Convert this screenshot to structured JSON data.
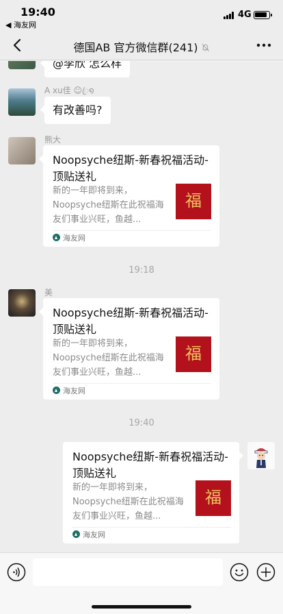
{
  "status_bar": {
    "time": "19:40",
    "back_app": "◀ 海友网",
    "network": "4G",
    "icons": {
      "signal": "signal-bars-icon",
      "battery": "battery-icon"
    }
  },
  "nav": {
    "title": "德国AB  官方微信群(241)",
    "icons": {
      "back": "chevron-left-icon",
      "mute": "mute-bell-icon",
      "more": "more-dots-icon"
    }
  },
  "messages": [
    {
      "type": "text",
      "text": "@李欣 怎么样"
    },
    {
      "type": "text",
      "sender": "A xu佳 ☺ꦿ໑",
      "text": "有改善吗?"
    },
    {
      "type": "link_card",
      "sender": "熊大",
      "card": {
        "title": "Noopsyche纽斯-新春祝福活动-顶贴送礼",
        "desc": "新的一年即将到来，Noopsyche纽斯在此祝福海友们事业兴旺，鱼越...",
        "source": "海友网",
        "thumb_text": "福"
      }
    },
    {
      "type": "time",
      "text": "19:18"
    },
    {
      "type": "link_card",
      "sender": "美",
      "card": {
        "title": "Noopsyche纽斯-新春祝福活动-顶贴送礼",
        "desc": "新的一年即将到来，Noopsyche纽斯在此祝福海友们事业兴旺，鱼越...",
        "source": "海友网",
        "thumb_text": "福"
      }
    },
    {
      "type": "time",
      "text": "19:40"
    },
    {
      "type": "link_card",
      "outgoing": true,
      "card": {
        "title": "Noopsyche纽斯-新春祝福活动-顶贴送礼",
        "desc": "新的一年即将到来，Noopsyche纽斯在此祝福海友们事业兴旺，鱼越...",
        "source": "海友网",
        "thumb_text": "福"
      }
    }
  ],
  "input_bar": {
    "icons": {
      "voice": "voice-icon",
      "emoji": "emoji-icon",
      "plus": "plus-icon"
    }
  },
  "colors": {
    "background": "#ededed",
    "bubble": "#ffffff",
    "thumb_red": "#b3121c",
    "thumb_gold": "#f0c060"
  }
}
